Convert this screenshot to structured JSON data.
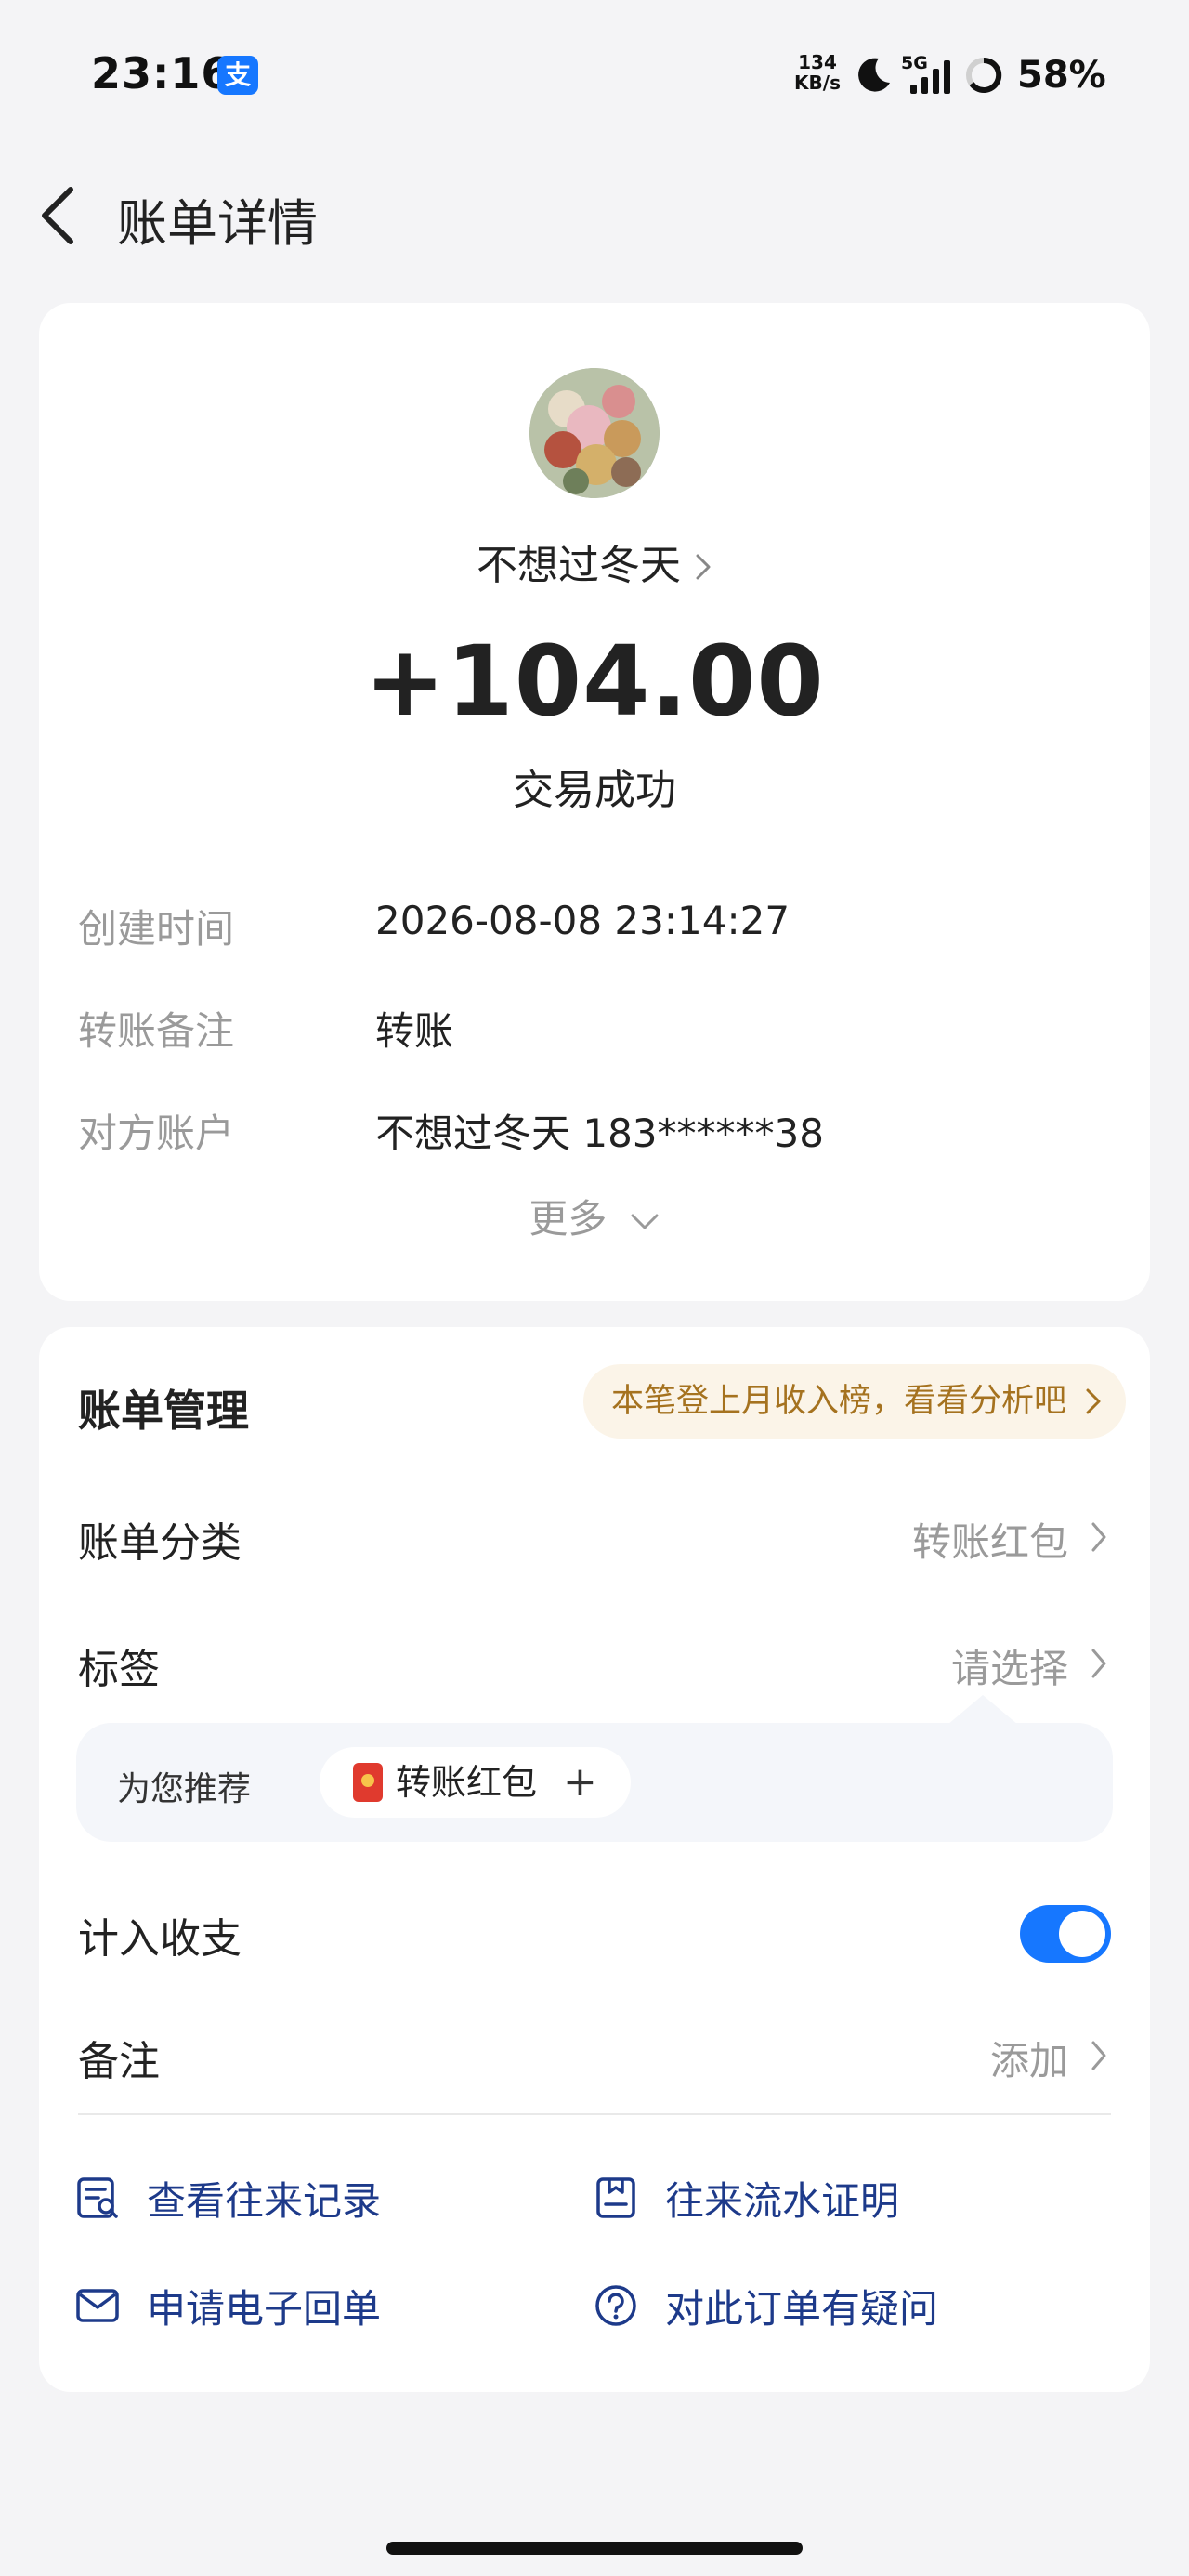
{
  "status_bar": {
    "time": "23:16",
    "app_badge": "支",
    "net_speed_value": "134",
    "net_speed_unit": "KB/s",
    "network": "5G",
    "battery": "58%"
  },
  "nav": {
    "title": "账单详情"
  },
  "transaction": {
    "payee": "不想过冬天",
    "amount": "+104.00",
    "status": "交易成功",
    "details": [
      {
        "label": "创建时间",
        "value": "2026-08-08 23:14:27"
      },
      {
        "label": "转账备注",
        "value": "转账"
      },
      {
        "label": "对方账户",
        "value": "不想过冬天 183******38"
      }
    ],
    "more_label": "更多"
  },
  "management": {
    "title": "账单管理",
    "promo_pill": "本笔登上月收入榜，看看分析吧",
    "category": {
      "label": "账单分类",
      "value": "转账红包"
    },
    "tag": {
      "label": "标签",
      "value": "请选择"
    },
    "recommend": {
      "label": "为您推荐",
      "chip": "转账红包",
      "chip_action": "+"
    },
    "include_in_stats": {
      "label": "计入收支",
      "enabled": true
    },
    "note": {
      "label": "备注",
      "value": "添加"
    }
  },
  "actions": [
    {
      "label": "查看往来记录",
      "icon": "records-icon"
    },
    {
      "label": "往来流水证明",
      "icon": "statement-icon"
    },
    {
      "label": "申请电子回单",
      "icon": "mail-icon"
    },
    {
      "label": "对此订单有疑问",
      "icon": "question-icon"
    }
  ],
  "colors": {
    "accent": "#1677ff",
    "link": "#1d3a8a",
    "promo_text": "#a5721f",
    "promo_bg": "#fbf4e8"
  }
}
